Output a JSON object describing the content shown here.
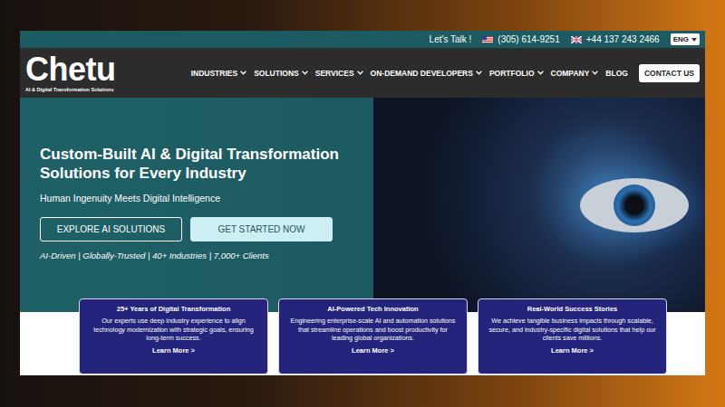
{
  "topbar": {
    "prompt": "Let's Talk !",
    "phones": [
      {
        "number": "(305) 614-9251"
      },
      {
        "number": "+44 137 243 2466"
      }
    ],
    "language": {
      "label": "ENG",
      "dropdown": true
    }
  },
  "logo": {
    "name": "Chetu",
    "tagline": "AI & Digital Transformation Solutions"
  },
  "nav": {
    "items": [
      {
        "label": "INDUSTRIES",
        "dropdown": true
      },
      {
        "label": "SOLUTIONS",
        "dropdown": true
      },
      {
        "label": "SERVICES",
        "dropdown": true
      },
      {
        "label": "ON-DEMAND DEVELOPERS",
        "dropdown": true
      },
      {
        "label": "PORTFOLIO",
        "dropdown": true
      },
      {
        "label": "COMPANY",
        "dropdown": true
      },
      {
        "label": "BLOG",
        "dropdown": false
      }
    ],
    "cta": "CONTACT US"
  },
  "hero": {
    "title": "Custom-Built AI & Digital Transformation Solutions for Every Industry",
    "subtitle": "Human Ingenuity Meets Digital Intelligence",
    "buttons": [
      {
        "label": "EXPLORE AI SOLUTIONS",
        "kind": "outline"
      },
      {
        "label": "GET STARTED NOW",
        "kind": "filled"
      }
    ],
    "tagline": "AI-Driven | Globally-Trusted | 40+ Industries | 7,000+ Clients"
  },
  "cards": [
    {
      "title": "25+ Years of Digital Transformation",
      "body": "Our experts use deep industry experience to align technology modernization with strategic goals, ensuring long-term success.",
      "link": "Learn More >"
    },
    {
      "title": "AI-Powered Tech Innovation",
      "body": "Engineering enterprise-scale AI and automation solutions that streamline operations and boost productivity for leading global organizations.",
      "link": "Learn More >"
    },
    {
      "title": "Real-World Success Stories",
      "body": "We achieve tangible business impacts through scalable, secure, and industry-specific digital solutions that help our clients save millions.",
      "link": "Learn More >"
    }
  ]
}
